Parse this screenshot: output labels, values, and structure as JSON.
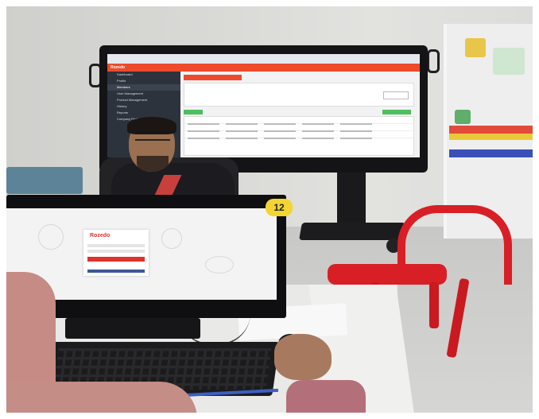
{
  "tv_screen": {
    "app_name": "Rozedo",
    "sidebar_items": [
      "Dashboard",
      "Profile",
      "Members",
      "User Management",
      "Product Management",
      "History",
      "Reports",
      "Company Profile"
    ],
    "station_number": "12"
  },
  "monitor_screen": {
    "login_logo": "Rozedo"
  },
  "colors": {
    "accent": "#ee4a2b",
    "sidebar": "#2c333d",
    "success": "#4cbf5f",
    "badge": "#f3d431",
    "chair": "#d81f26"
  }
}
